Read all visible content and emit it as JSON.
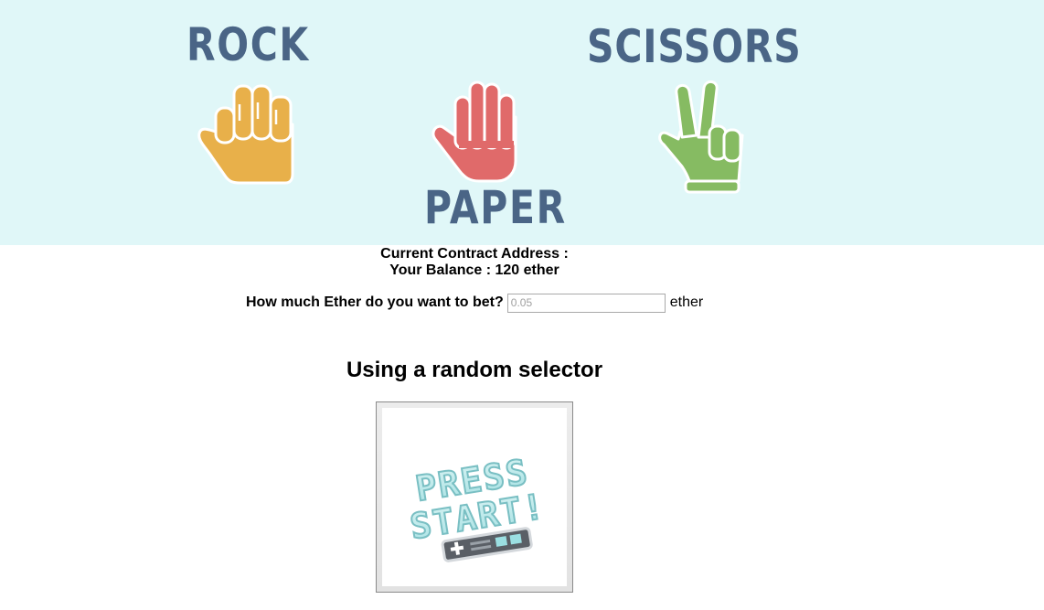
{
  "banner": {
    "rock_title": "ROCK",
    "paper_title": "PAPER",
    "scissors_title": "SCISSORS",
    "colors": {
      "background": "#e0f7f8",
      "title": "#4a6586",
      "rock": "#e8b04a",
      "paper": "#e06a6a",
      "scissors": "#86bb62"
    }
  },
  "info": {
    "contract_address_label": "Current Contract Address :",
    "balance_text": "Your Balance : 120 ether"
  },
  "bet": {
    "label": "How much Ether do you want to bet?",
    "input_placeholder": "0.05",
    "unit": "ether"
  },
  "selector": {
    "title": "Using a random selector",
    "button_text_line1": "PRESS",
    "button_text_line2": "START!",
    "button_icon": "gamepad-icon"
  }
}
